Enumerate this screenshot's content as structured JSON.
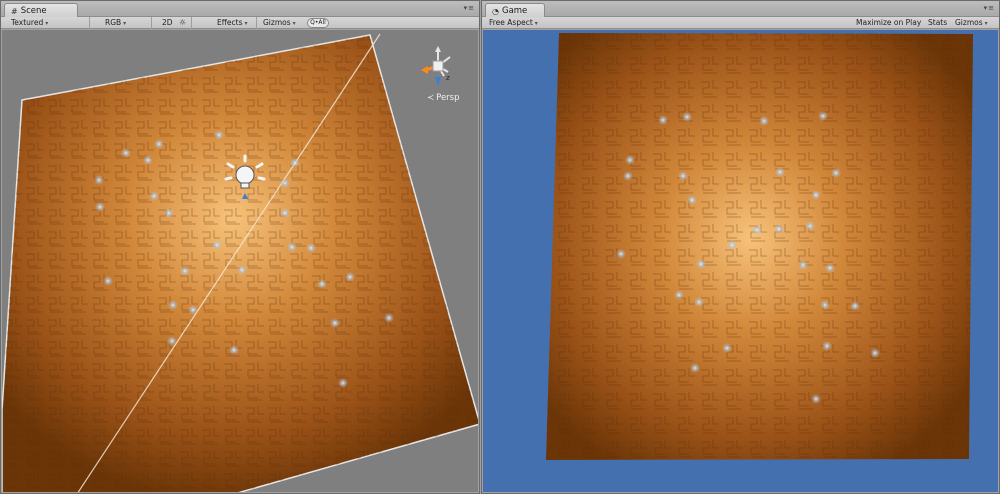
{
  "scene": {
    "tab_label": "Scene",
    "toolbar": {
      "shading_mode": "Textured",
      "render_mode": "RGB",
      "view_mode": "2D",
      "effects": "Effects",
      "gizmos": "Gizmos",
      "search_placeholder": "Q•All"
    },
    "gizmo": {
      "projection_label": "Persp",
      "y_axis": "y",
      "z_axis": "z"
    }
  },
  "game": {
    "tab_label": "Game",
    "toolbar": {
      "aspect": "Free Aspect",
      "maximize_on_play": "Maximize on Play",
      "stats": "Stats",
      "gizmos": "Gizmos"
    }
  },
  "colors": {
    "scene_background": "#7f7f7f",
    "game_background": "#4570b0",
    "floor_glow": "#f7b866",
    "floor_dark": "#6b3507",
    "point_light_glow": "#a9c7e6"
  }
}
